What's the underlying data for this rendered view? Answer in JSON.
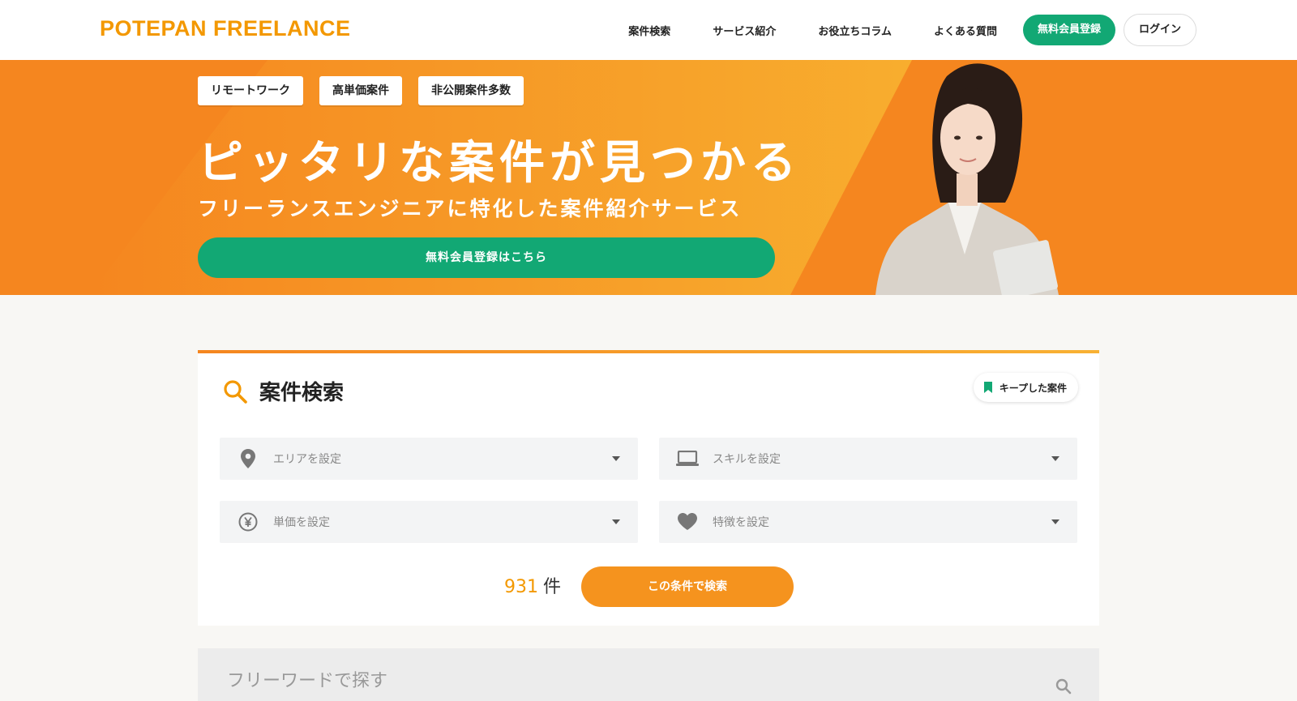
{
  "header": {
    "logo": "POTEPAN FREELANCE",
    "nav": [
      "案件検索",
      "サービス紹介",
      "お役立ちコラム",
      "よくある質問"
    ],
    "register_label": "無料会員登録",
    "login_label": "ログイン"
  },
  "hero": {
    "tags": [
      "リモートワーク",
      "高単価案件",
      "非公開案件多数"
    ],
    "title": "ピッタリな案件が見つかる",
    "subtitle": "フリーランスエンジニアに特化した案件紹介サービス",
    "cta_label": "無料会員登録はこちら"
  },
  "search": {
    "title": "案件検索",
    "keep_label": "キープした案件",
    "filters": [
      {
        "label": "エリアを設定",
        "icon": "location-pin-icon"
      },
      {
        "label": "スキルを設定",
        "icon": "laptop-icon"
      },
      {
        "label": "単価を設定",
        "icon": "yen-icon"
      },
      {
        "label": "特徴を設定",
        "icon": "heart-icon"
      }
    ],
    "count_value": "931",
    "count_unit": "件",
    "submit_label": "この条件で検索"
  },
  "freeword": {
    "placeholder": "フリーワードで探す"
  },
  "colors": {
    "brand_orange": "#f39800",
    "hero_orange": "#f5861f",
    "green": "#12a874",
    "search_button": "#f5931e"
  }
}
